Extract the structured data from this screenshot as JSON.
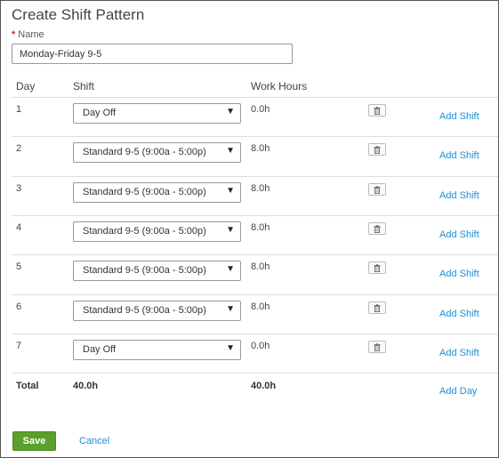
{
  "form": {
    "title": "Create Shift Pattern",
    "name_label": "Name",
    "required_marker": "*",
    "name_value": "Monday-Friday 9-5"
  },
  "table": {
    "headers": {
      "day": "Day",
      "shift": "Shift",
      "work_hours": "Work Hours"
    },
    "trash_icon": "trash-icon",
    "rows": [
      {
        "day": "1",
        "shift": "Day Off",
        "hours": "0.0h",
        "add_label": "Add Shift"
      },
      {
        "day": "2",
        "shift": "Standard 9-5 (9:00a - 5:00p)",
        "hours": "8.0h",
        "add_label": "Add Shift"
      },
      {
        "day": "3",
        "shift": "Standard 9-5 (9:00a - 5:00p)",
        "hours": "8.0h",
        "add_label": "Add Shift"
      },
      {
        "day": "4",
        "shift": "Standard 9-5 (9:00a - 5:00p)",
        "hours": "8.0h",
        "add_label": "Add Shift"
      },
      {
        "day": "5",
        "shift": "Standard 9-5 (9:00a - 5:00p)",
        "hours": "8.0h",
        "add_label": "Add Shift"
      },
      {
        "day": "6",
        "shift": "Standard 9-5 (9:00a - 5:00p)",
        "hours": "8.0h",
        "add_label": "Add Shift"
      },
      {
        "day": "7",
        "shift": "Day Off",
        "hours": "0.0h",
        "add_label": "Add Shift"
      }
    ],
    "total": {
      "label": "Total",
      "shift_total": "40.0h",
      "hours_total": "40.0h",
      "add_day_label": "Add Day"
    }
  },
  "actions": {
    "save_label": "Save",
    "cancel_label": "Cancel"
  },
  "colors": {
    "accent_link": "#1a8fd6",
    "save_button": "#5aa02c",
    "required": "#c0392b"
  }
}
